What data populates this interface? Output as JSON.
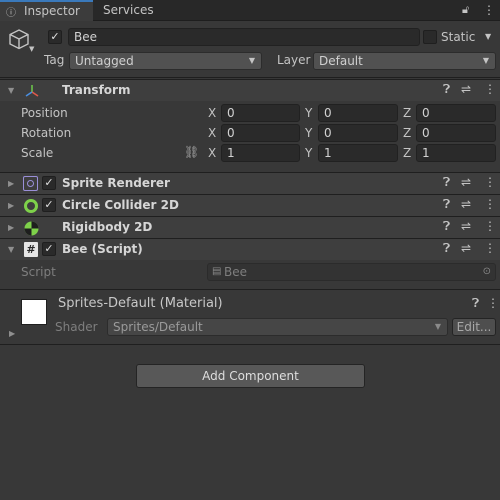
{
  "tabs": {
    "inspector": "Inspector",
    "services": "Services",
    "lock_icon": "lock-icon",
    "menu_icon": "kebab-icon"
  },
  "object": {
    "name": "Bee",
    "active": true,
    "static_label": "Static",
    "tag_label": "Tag",
    "tag_value": "Untagged",
    "layer_label": "Layer",
    "layer_value": "Default"
  },
  "transform": {
    "title": "Transform",
    "position_label": "Position",
    "rotation_label": "Rotation",
    "scale_label": "Scale",
    "axis_x": "X",
    "axis_y": "Y",
    "axis_z": "Z",
    "position": [
      "0",
      "0",
      "0"
    ],
    "rotation": [
      "0",
      "0",
      "0"
    ],
    "scale": [
      "1",
      "1",
      "1"
    ]
  },
  "components": {
    "sprite_renderer": "Sprite Renderer",
    "circle_collider": "Circle Collider 2D",
    "rigidbody": "Rigidbody 2D",
    "bee_script": "Bee (Script)"
  },
  "script": {
    "label": "Script",
    "value": "Bee"
  },
  "material": {
    "title": "Sprites-Default (Material)",
    "shader_label": "Shader",
    "shader_value": "Sprites/Default",
    "edit_button": "Edit..."
  },
  "add_component": "Add Component",
  "colors": {
    "background": "#383838",
    "accent": "#3a79bb",
    "header": "#3e3e3e"
  }
}
